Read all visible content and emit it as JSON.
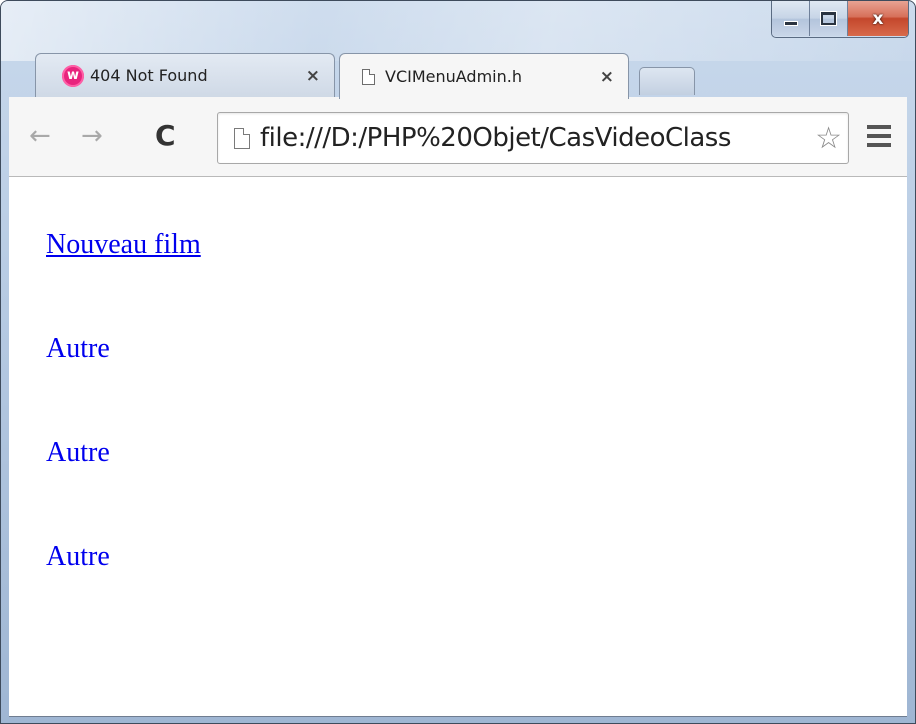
{
  "window": {
    "minimize_label": "_",
    "maximize_label": "□",
    "close_label": "x"
  },
  "tabs": [
    {
      "title": "404 Not Found",
      "favicon": "wamp-icon",
      "close_label": "×",
      "active": false
    },
    {
      "title": "VCIMenuAdmin.h",
      "favicon": "page-icon",
      "close_label": "×",
      "active": true
    }
  ],
  "toolbar": {
    "back_label": "←",
    "forward_label": "→",
    "reload_label": "C",
    "url": "file:///D:/PHP%20Objet/CasVideoClass",
    "bookmark_label": "☆"
  },
  "content": {
    "links": [
      {
        "label": "Nouveau film"
      }
    ],
    "entries": [
      {
        "label": "Autre"
      },
      {
        "label": "Autre"
      },
      {
        "label": "Autre"
      }
    ]
  },
  "colors": {
    "link": "#0000ee",
    "close_button": "#c4472c",
    "wamp_icon": "#e8247d"
  }
}
